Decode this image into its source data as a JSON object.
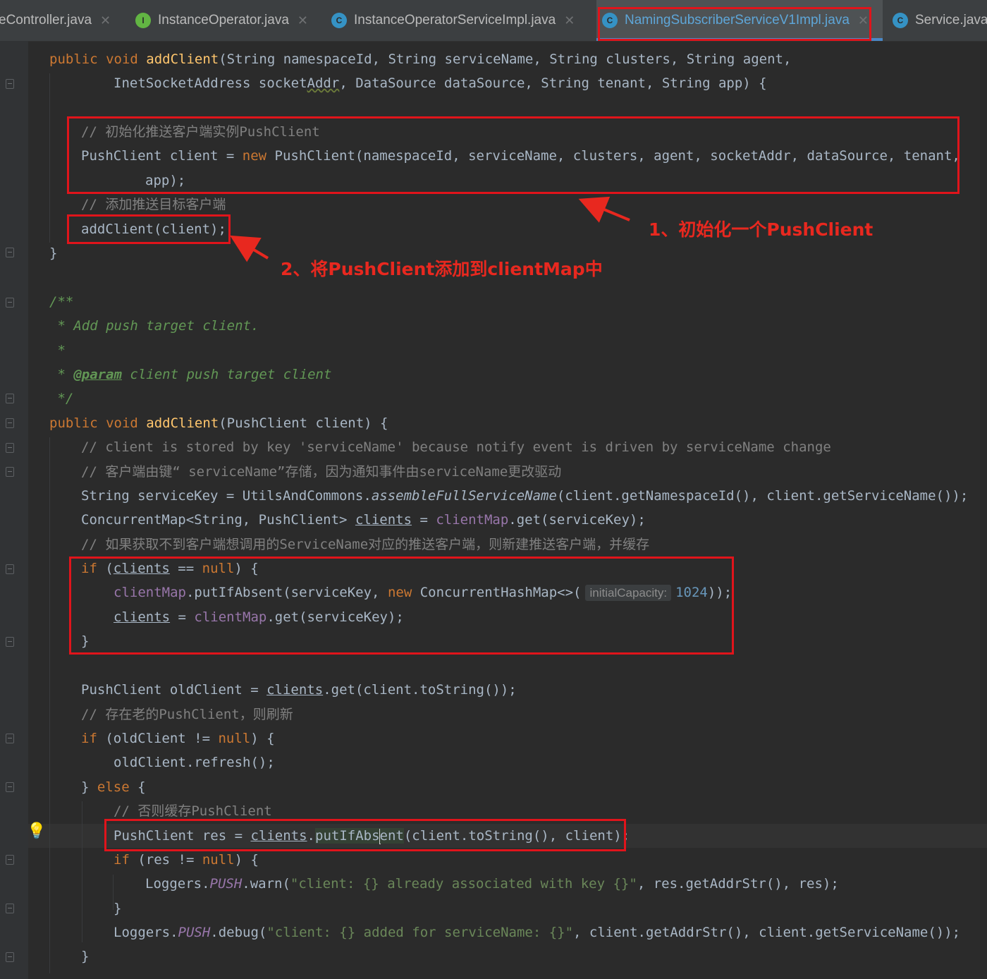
{
  "tabs": [
    {
      "label": "eController.java",
      "icon": "",
      "active": false
    },
    {
      "label": "InstanceOperator.java",
      "icon": "I",
      "active": false
    },
    {
      "label": "InstanceOperatorServiceImpl.java",
      "icon": "C",
      "active": false
    },
    {
      "label": "NamingSubscriberServiceV1Impl.java",
      "icon": "C",
      "active": true
    },
    {
      "label": "Service.java",
      "icon": "C",
      "active": false
    }
  ],
  "code": {
    "l1": {
      "t1": "public void ",
      "t2": "addClient",
      "t3": "(String namespaceId, String serviceName, String clusters, String agent,"
    },
    "l2": {
      "t1": "InetSocketAddress socket",
      "t2": "Addr",
      "t3": ", DataSource dataSource, String tenant, String app) {"
    },
    "l3": "// 初始化推送客户端实例PushClient",
    "l4": {
      "t1": "PushClient client = ",
      "t2": "new ",
      "t3": "PushClient(namespaceId, serviceName, clusters, agent, socketAddr, dataSource, tenant,"
    },
    "l5": "app);",
    "l6": "// 添加推送目标客户端",
    "l7": "addClient(client);",
    "l8": "}",
    "l9": "/**",
    "l10": " * Add push target client.",
    "l11": " *",
    "l12": {
      "t1": " * ",
      "t2": "@param",
      "t3": " client push target client"
    },
    "l13": " */",
    "l14": {
      "t1": "public void ",
      "t2": "addClient",
      "t3": "(PushClient client) {"
    },
    "l15": "// client is stored by key 'serviceName' because notify event is driven by serviceName change",
    "l16": "// 客户端由键“ serviceName”存储，因为通知事件由serviceName更改驱动",
    "l17": {
      "t1": "String serviceKey = UtilsAndCommons.",
      "t2": "assembleFullServiceName",
      "t3": "(client.getNamespaceId(), client.getServiceName());"
    },
    "l18": {
      "t1": "ConcurrentMap<String, PushClient> ",
      "t2": "clients",
      "t3": " = ",
      "t4": "clientMap",
      "t5": ".get(serviceKey);"
    },
    "l19": "// 如果获取不到客户端想调用的ServiceName对应的推送客户端，则新建推送客户端，并缓存",
    "l20": {
      "t1": "if ",
      "t2": "(",
      "t3": "clients",
      "t4": " == ",
      "t5": "null",
      "t6": ") {"
    },
    "l21": {
      "t1": "clientMap",
      "t2": ".putIfAbsent(serviceKey, ",
      "t3": "new ",
      "t4": "ConcurrentHashMap<>(",
      "hint": "initialCapacity:",
      "t5": "1024",
      "t6": "));"
    },
    "l22": {
      "t1": "clients",
      "t2": " = ",
      "t3": "clientMap",
      "t4": ".get(serviceKey);"
    },
    "l23": "}",
    "l24": {
      "t1": "PushClient oldClient = ",
      "t2": "clients",
      "t3": ".get(client.toString());"
    },
    "l25": "// 存在老的PushClient，则刷新",
    "l26": {
      "t1": "if ",
      "t2": "(oldClient != ",
      "t3": "null",
      "t4": ") {"
    },
    "l27": "oldClient.refresh();",
    "l28": {
      "t1": "} ",
      "t2": "else ",
      "t3": "{"
    },
    "l29": "// 否则缓存PushClient",
    "l30": {
      "t1": "PushClient res = ",
      "t2": "clients",
      "t3": ".",
      "t4": "putIfAbs",
      "t5": "ent",
      "t6": "(client.toString(), client);"
    },
    "l31": {
      "t1": "if ",
      "t2": "(res != ",
      "t3": "null",
      "t4": ") {"
    },
    "l32": {
      "t1": "Loggers.",
      "t2": "PUSH",
      "t3": ".warn(",
      "t4": "\"client: {} already associated with key {}\"",
      "t5": ", res.getAddrStr(), res);"
    },
    "l33": "}",
    "l34": {
      "t1": "Loggers.",
      "t2": "PUSH",
      "t3": ".debug(",
      "t4": "\"client: {} added for serviceName: {}\"",
      "t5": ", client.getAddrStr(), client.getServiceName());"
    },
    "l35": "}"
  },
  "annotations": {
    "a1": "1、初始化一个PushClient",
    "a2": "2、将PushClient添加到clientMap中"
  },
  "colors": {
    "highlight": "#e0141b",
    "keyword": "#cc7832",
    "method": "#ffc66d",
    "comment": "#808080",
    "javadoc": "#629755",
    "field": "#9876aa"
  }
}
